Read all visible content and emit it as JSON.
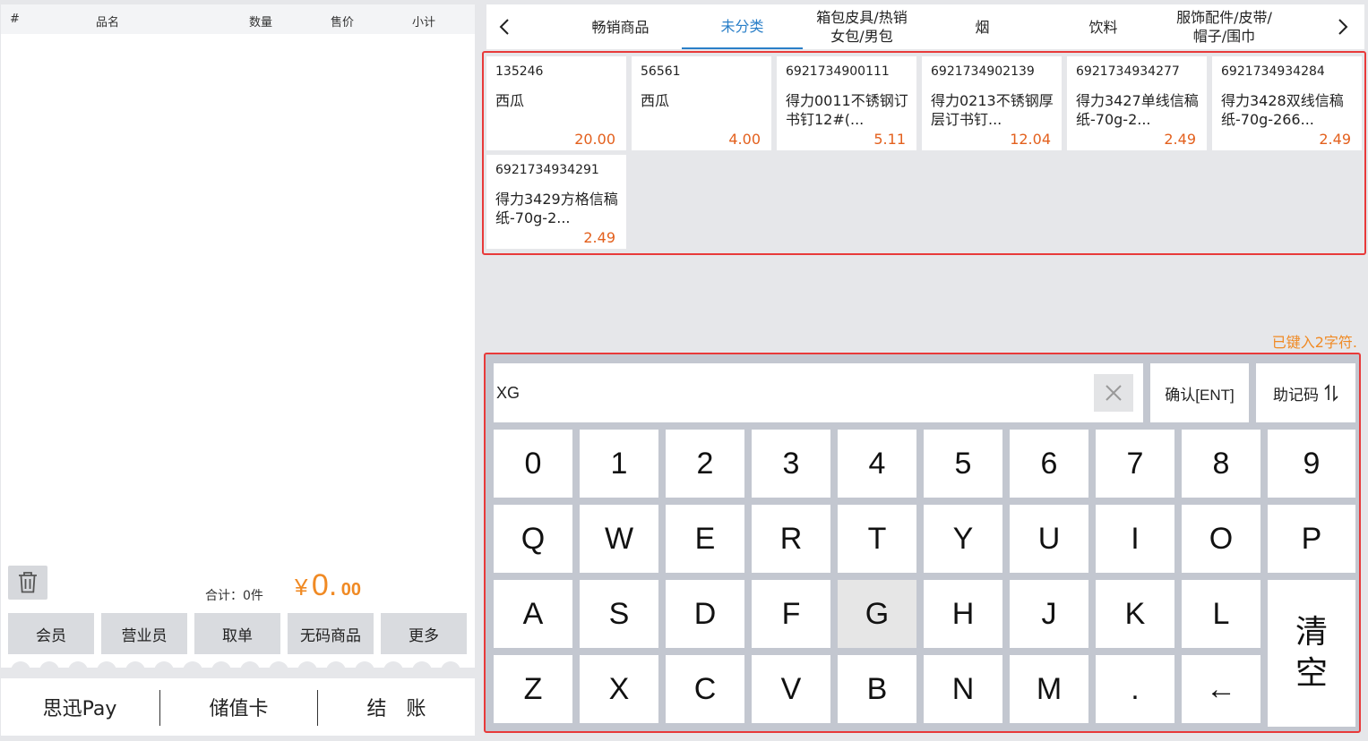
{
  "cart": {
    "columns": [
      "#",
      "品名",
      "数量",
      "售价",
      "小计"
    ],
    "total_label": "合计：0件",
    "total_currency": "¥",
    "total_int": "0.",
    "total_dec": "00"
  },
  "functions": [
    {
      "label": "会员"
    },
    {
      "label": "营业员"
    },
    {
      "label": "取单"
    },
    {
      "label": "无码商品"
    },
    {
      "label": "更多"
    }
  ],
  "payment": [
    {
      "label": "思迅Pay"
    },
    {
      "label": "储值卡"
    },
    {
      "label": "结　账"
    }
  ],
  "categories": [
    {
      "label": "畅销商品"
    },
    {
      "label": "未分类"
    },
    {
      "label": "箱包皮具/热销\n女包/男包"
    },
    {
      "label": "烟"
    },
    {
      "label": "饮料"
    },
    {
      "label": "服饰配件/皮带/\n帽子/围巾"
    }
  ],
  "active_category": "未分类",
  "products": [
    {
      "code": "135246",
      "name": "西瓜",
      "price": "20.00"
    },
    {
      "code": "56561",
      "name": "西瓜",
      "price": "4.00"
    },
    {
      "code": "6921734900111",
      "name": "得力0011不锈钢订书钉12#(...",
      "price": "5.11"
    },
    {
      "code": "6921734902139",
      "name": "得力0213不锈钢厚层订书钉...",
      "price": "12.04"
    },
    {
      "code": "6921734934277",
      "name": "得力3427单线信稿纸-70g-2...",
      "price": "2.49"
    },
    {
      "code": "6921734934284",
      "name": "得力3428双线信稿纸-70g-266...",
      "price": "2.49"
    },
    {
      "code": "6921734934291",
      "name": "得力3429方格信稿纸-70g-2...",
      "price": "2.49"
    }
  ],
  "keypad": {
    "status": "已键入2字符.",
    "input_value": "XG",
    "confirm_label": "确认[ENT]",
    "mnemonic_label": "助记码",
    "clear_all_label": "清\n空",
    "pressed_key": "G",
    "rows": [
      [
        "0",
        "1",
        "2",
        "3",
        "4",
        "5",
        "6",
        "7",
        "8",
        "9"
      ],
      [
        "Q",
        "W",
        "E",
        "R",
        "T",
        "Y",
        "U",
        "I",
        "O",
        "P"
      ],
      [
        "A",
        "S",
        "D",
        "F",
        "G",
        "H",
        "J",
        "K",
        "L"
      ],
      [
        "Z",
        "X",
        "C",
        "V",
        "B",
        "N",
        "M",
        ".",
        "←"
      ]
    ]
  },
  "icons": {
    "trash": "trash-icon",
    "clear": "close-icon",
    "prev": "chevron-left-icon",
    "next": "chevron-right-icon",
    "sort": "sort-arrows-icon"
  },
  "colors": {
    "accent_orange": "#f08a24",
    "price_orange": "#e3601d",
    "tab_blue": "#2a7fc8",
    "highlight_red": "#e83a3a"
  }
}
